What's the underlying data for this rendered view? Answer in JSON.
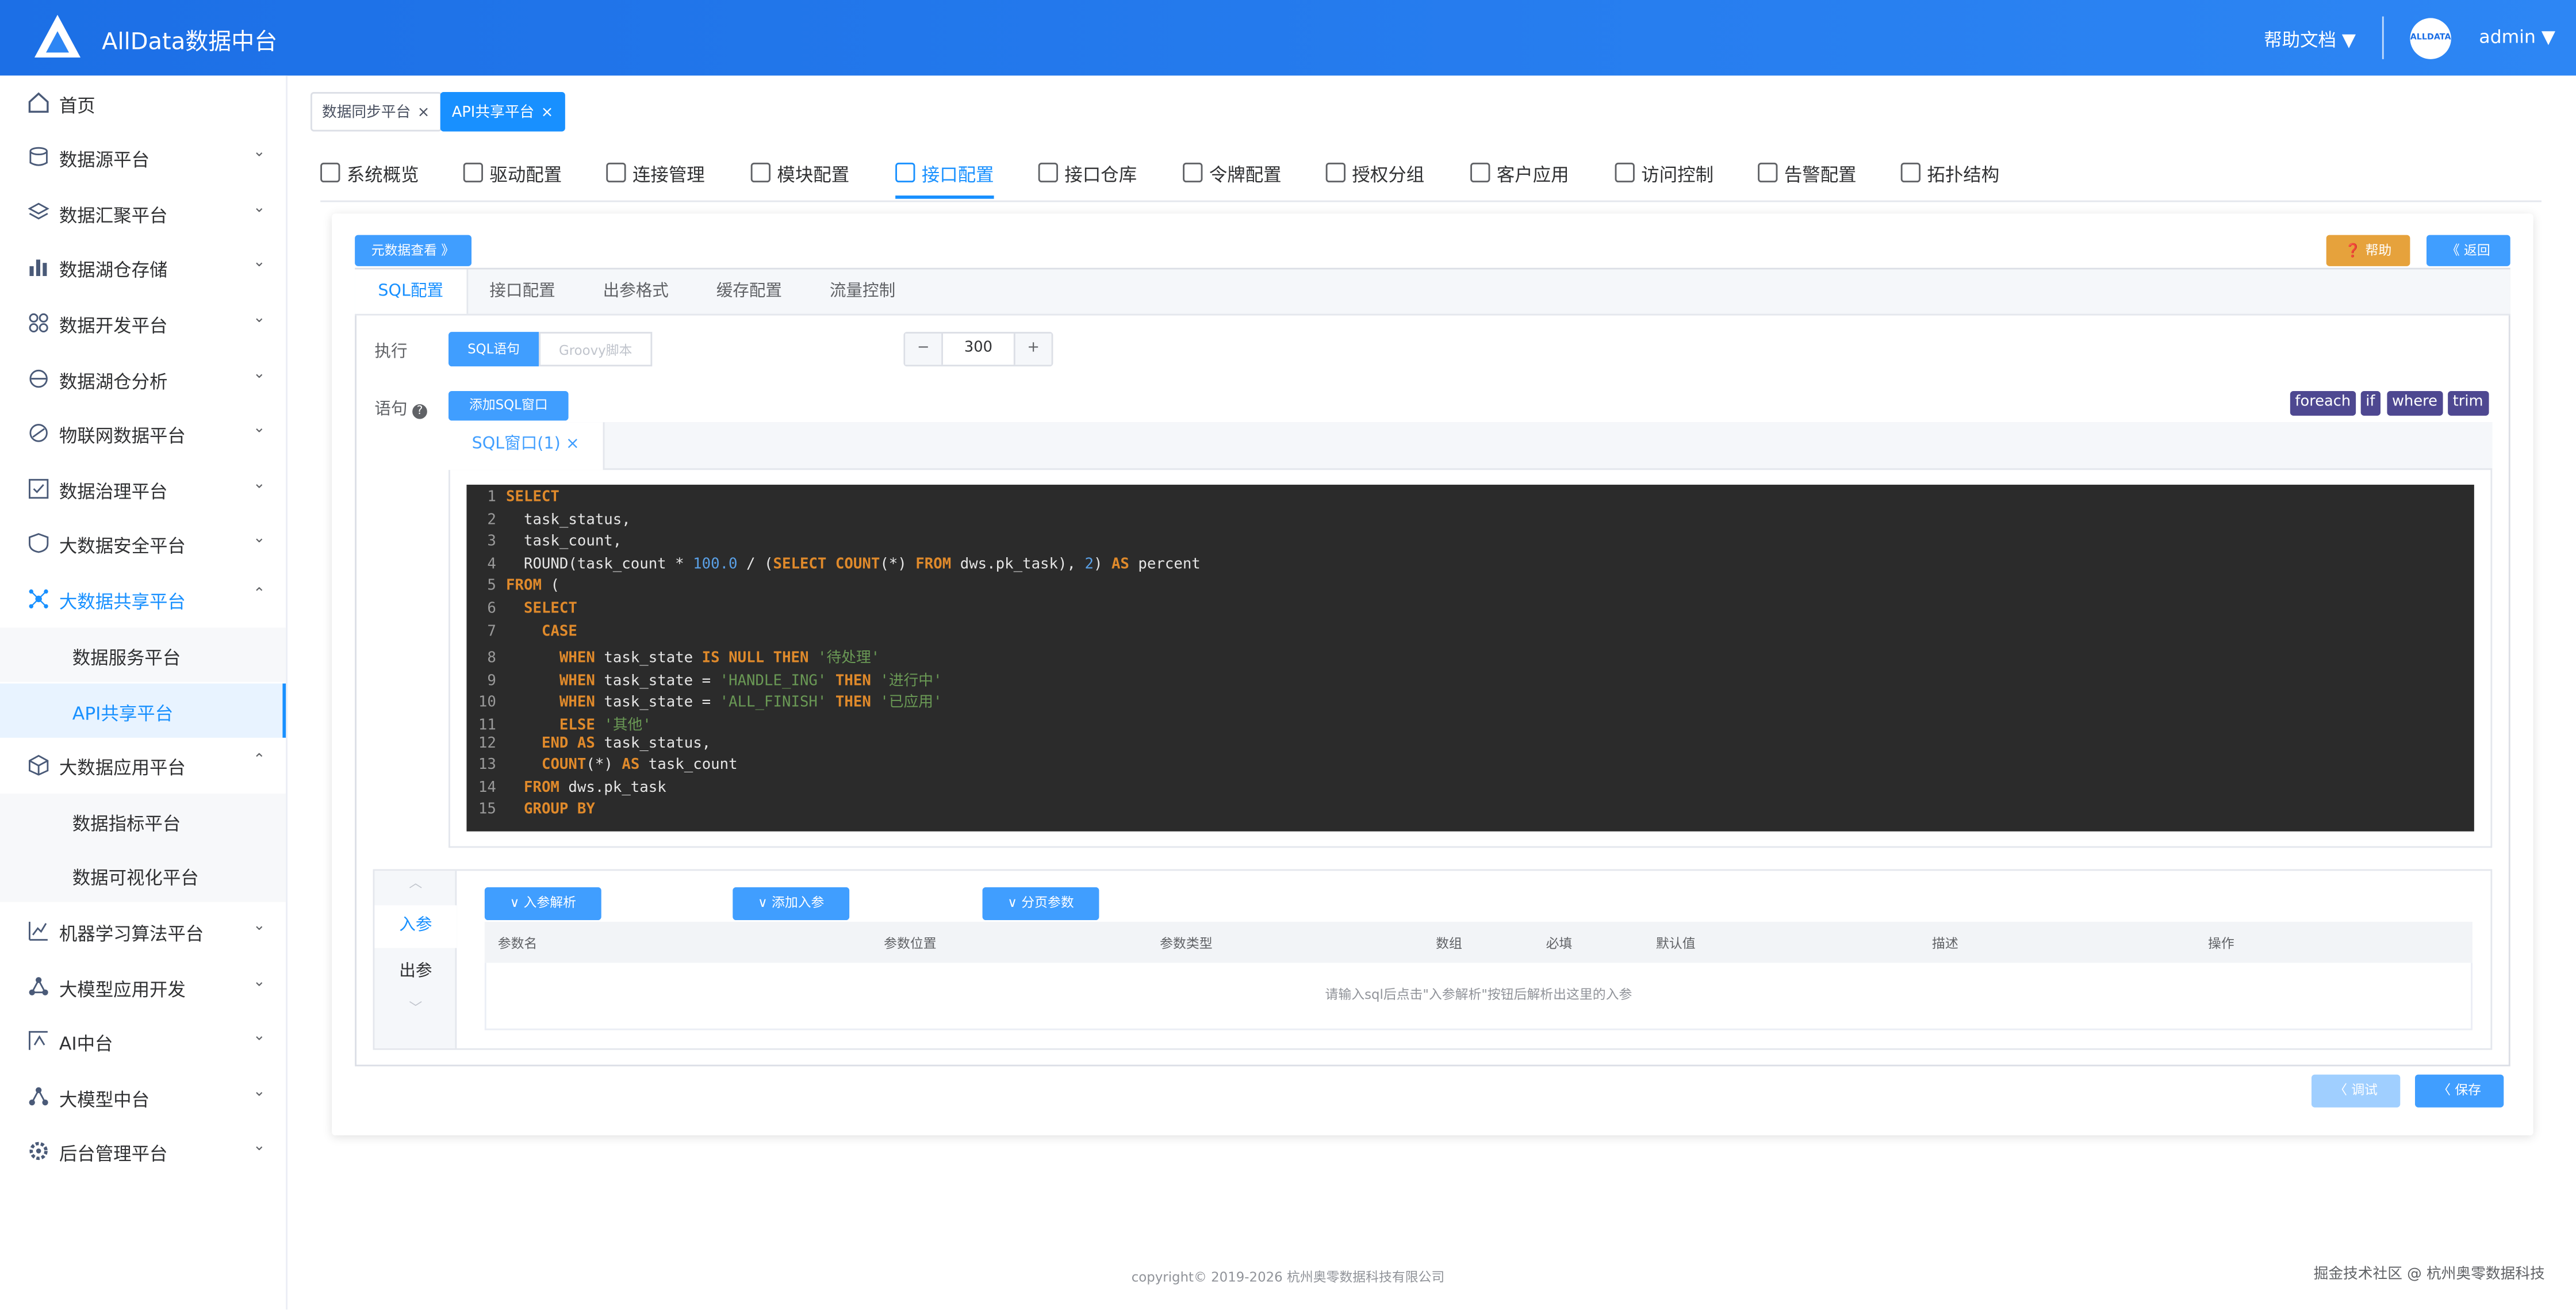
{
  "header": {
    "title": "AllData数据中台",
    "help_doc": "帮助文档 ▼",
    "avatar_text": "ALLDATA",
    "user": "admin ▼",
    "bg_color": "#1c6fe6"
  },
  "sidebar": {
    "items": [
      {
        "label": "首页",
        "icon": "home-icon"
      },
      {
        "label": "数据源平台",
        "icon": "database-icon"
      },
      {
        "label": "数据汇聚平台",
        "icon": "layers-icon"
      },
      {
        "label": "数据湖仓存储",
        "icon": "bar-chart-icon"
      },
      {
        "label": "数据开发平台",
        "icon": "grid-icon"
      },
      {
        "label": "数据湖仓分析",
        "icon": "analysis-icon"
      },
      {
        "label": "物联网数据平台",
        "icon": "iot-icon"
      },
      {
        "label": "数据治理平台",
        "icon": "governance-icon"
      },
      {
        "label": "大数据安全平台",
        "icon": "shield-icon"
      },
      {
        "label": "大数据共享平台",
        "icon": "share-icon"
      },
      {
        "label": "数据服务平台",
        "icon": ""
      },
      {
        "label": "API共享平台",
        "icon": ""
      },
      {
        "label": "大数据应用平台",
        "icon": "cube-icon"
      },
      {
        "label": "数据指标平台",
        "icon": ""
      },
      {
        "label": "数据可视化平台",
        "icon": ""
      },
      {
        "label": "机器学习算法平台",
        "icon": "ml-icon"
      },
      {
        "label": "大模型应用开发",
        "icon": "model-icon"
      },
      {
        "label": "AI中台",
        "icon": "ai-icon"
      },
      {
        "label": "大模型中台",
        "icon": "llm-icon"
      },
      {
        "label": "后台管理平台",
        "icon": "settings-icon"
      }
    ]
  },
  "tags": [
    {
      "label": "数据同步平台"
    },
    {
      "label": "API共享平台"
    }
  ],
  "nav_tabs": [
    "系统概览",
    "驱动配置",
    "连接管理",
    "模块配置",
    "接口配置",
    "接口仓库",
    "令牌配置",
    "授权分组",
    "客户应用",
    "访问控制",
    "告警配置",
    "拓扑结构"
  ],
  "card": {
    "meta_button": "元数据查看 》",
    "help_button": "❓ 帮助",
    "back_button": "《 返回",
    "sub_tabs": [
      "SQL配置",
      "接口配置",
      "出参格式",
      "缓存配置",
      "流量控制"
    ],
    "exec_label": "执行",
    "exec_sql": "SQL语句",
    "exec_groovy": "Groovy脚本",
    "stepper": {
      "minus": "−",
      "value": "300",
      "plus": "+"
    },
    "sentence_label": "语句",
    "add_sql_button": "添加SQL窗口",
    "keyword_tags": [
      "foreach",
      "if",
      "where",
      "trim"
    ],
    "editor_tab": "SQL窗口(1)",
    "editor_tab_close": "×"
  },
  "params": {
    "tab_in": "入参",
    "tab_out": "出参",
    "buttons": [
      "∨ 入参解析",
      "∨ 添加入参",
      "∨ 分页参数"
    ],
    "columns": [
      "参数名",
      "参数位置",
      "参数类型",
      "数组",
      "必填",
      "默认值",
      "描述",
      "操作"
    ],
    "empty_text": "请输入sql后点击\"入参解析\"按钮后解析出这里的入参"
  },
  "footer_buttons": {
    "debug": "〈 调试",
    "save": "〈 保存"
  },
  "copyright": "copyright© 2019-2026 杭州奥零数据科技有限公司",
  "watermark": "掘金技术社区 @ 杭州奥零数据科技",
  "code_lines": [
    "SELECT",
    "  task_status,",
    "  task_count,",
    "  ROUND(task_count * 100.0 / (SELECT COUNT(*) FROM dws.pk_task), 2) AS percent",
    "FROM (",
    "  SELECT",
    "    CASE",
    "      WHEN task_state IS NULL THEN '待处理'",
    "      WHEN task_state = 'HANDLE_ING' THEN '进行中'",
    "      WHEN task_state = 'ALL_FINISH' THEN '已应用'",
    "      ELSE '其他'",
    "    END AS task_status,",
    "    COUNT(*) AS task_count",
    "  FROM dws.pk_task",
    "  GROUP BY"
  ]
}
